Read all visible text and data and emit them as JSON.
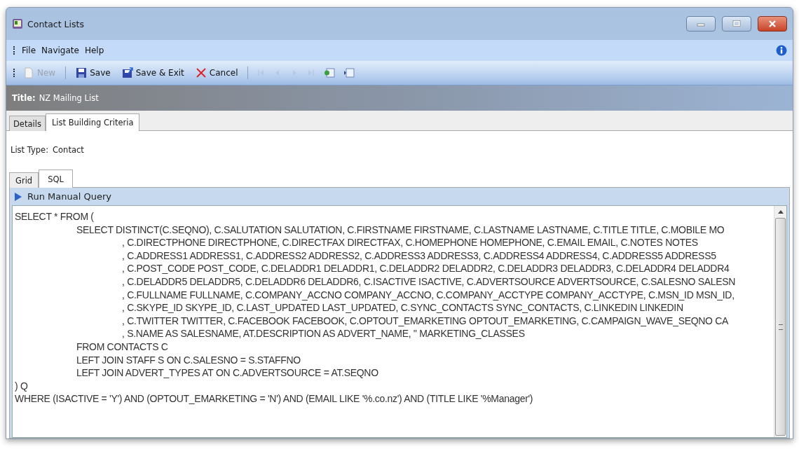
{
  "window": {
    "title": "Contact Lists"
  },
  "menu": [
    "File",
    "Navigate",
    "Help"
  ],
  "toolbar": [
    {
      "kind": "new",
      "label": "New",
      "disabled": true
    },
    {
      "kind": "save",
      "label": "Save",
      "disabled": false
    },
    {
      "kind": "save-exit",
      "label": "Save & Exit",
      "disabled": false
    },
    {
      "kind": "cancel",
      "label": "Cancel",
      "disabled": false
    }
  ],
  "nav_buttons": [
    {
      "kind": "first",
      "disabled": true
    },
    {
      "kind": "prev",
      "disabled": true
    },
    {
      "kind": "next",
      "disabled": true
    },
    {
      "kind": "last",
      "disabled": true
    },
    {
      "kind": "add",
      "disabled": false
    },
    {
      "kind": "go",
      "disabled": false
    }
  ],
  "title_band": {
    "label": "Title:",
    "value": "NZ Mailing List"
  },
  "tabs": [
    {
      "label": "Details",
      "selected": false
    },
    {
      "label": "List Building Criteria",
      "selected": true
    }
  ],
  "list_type": {
    "label": "List Type:",
    "value": "Contact"
  },
  "sub_tabs": [
    {
      "label": "Grid",
      "selected": false
    },
    {
      "label": "SQL",
      "selected": true
    }
  ],
  "run_query": "Run Manual Query",
  "sql_lines": [
    {
      "kind": "top",
      "text": "SELECT * FROM ("
    },
    {
      "kind": "inner",
      "text": "SELECT DISTINCT(C.SEQNO), C.SALUTATION SALUTATION, C.FIRSTNAME FIRSTNAME, C.LASTNAME LASTNAME, C.TITLE TITLE, C.MOBILE MO"
    },
    {
      "kind": "cont",
      "text": ", C.DIRECTPHONE DIRECTPHONE, C.DIRECTFAX DIRECTFAX, C.HOMEPHONE HOMEPHONE, C.EMAIL EMAIL, C.NOTES NOTES"
    },
    {
      "kind": "cont",
      "text": ", C.ADDRESS1 ADDRESS1, C.ADDRESS2 ADDRESS2, C.ADDRESS3 ADDRESS3, C.ADDRESS4 ADDRESS4, C.ADDRESS5 ADDRESS5"
    },
    {
      "kind": "cont",
      "text": ", C.POST_CODE POST_CODE, C.DELADDR1 DELADDR1, C.DELADDR2 DELADDR2, C.DELADDR3 DELADDR3, C.DELADDR4 DELADDR4"
    },
    {
      "kind": "cont",
      "text": ", C.DELADDR5 DELADDR5, C.DELADDR6 DELADDR6, C.ISACTIVE ISACTIVE, C.ADVERTSOURCE ADVERTSOURCE, C.SALESNO SALESN"
    },
    {
      "kind": "cont",
      "text": ", C.FULLNAME FULLNAME, C.COMPANY_ACCNO COMPANY_ACCNO, C.COMPANY_ACCTYPE COMPANY_ACCTYPE, C.MSN_ID MSN_ID,"
    },
    {
      "kind": "cont",
      "text": ", C.SKYPE_ID SKYPE_ID, C.LAST_UPDATED LAST_UPDATED, C.SYNC_CONTACTS SYNC_CONTACTS, C.LINKEDIN LINKEDIN"
    },
    {
      "kind": "cont",
      "text": ", C.TWITTER TWITTER, C.FACEBOOK FACEBOOK, C.OPTOUT_EMARKETING OPTOUT_EMARKETING, C.CAMPAIGN_WAVE_SEQNO CA"
    },
    {
      "kind": "cont",
      "text": ", S.NAME AS SALESNAME, AT.DESCRIPTION AS ADVERT_NAME, '' MARKETING_CLASSES"
    },
    {
      "kind": "inner",
      "text": "FROM CONTACTS C"
    },
    {
      "kind": "inner",
      "text": "LEFT JOIN STAFF S ON C.SALESNO = S.STAFFNO"
    },
    {
      "kind": "inner",
      "text": "LEFT JOIN ADVERT_TYPES AT ON C.ADVERTSOURCE = AT.SEQNO"
    },
    {
      "kind": "top",
      "text": ") Q"
    },
    {
      "kind": "top",
      "text": "WHERE (ISACTIVE = 'Y') AND (OPTOUT_EMARKETING = 'N') AND (EMAIL LIKE '%.co.nz') AND (TITLE LIKE '%Manager')"
    }
  ]
}
